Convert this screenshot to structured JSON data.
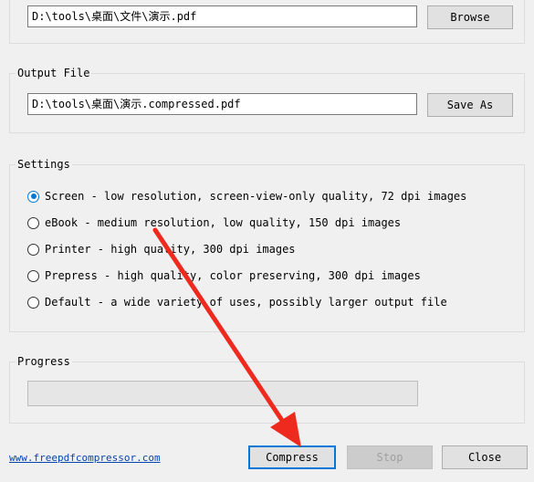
{
  "input_file": {
    "path": "D:\\tools\\桌面\\文件\\演示.pdf",
    "browse_label": "Browse"
  },
  "output_file": {
    "title": "Output File",
    "path": "D:\\tools\\桌面\\演示.compressed.pdf",
    "save_label": "Save As"
  },
  "settings": {
    "title": "Settings",
    "options": [
      {
        "label": "Screen - low resolution, screen-view-only quality, 72 dpi images",
        "checked": true
      },
      {
        "label": "eBook - medium resolution, low quality, 150 dpi images",
        "checked": false
      },
      {
        "label": "Printer - high quality, 300 dpi images",
        "checked": false
      },
      {
        "label": "Prepress - high quality, color preserving, 300 dpi images",
        "checked": false
      },
      {
        "label": "Default - a wide variety of uses, possibly larger output file",
        "checked": false
      }
    ]
  },
  "progress": {
    "title": "Progress",
    "value": 0
  },
  "footer": {
    "link_text": "www.freepdfcompressor.com",
    "compress_label": "Compress",
    "stop_label": "Stop",
    "close_label": "Close"
  },
  "colors": {
    "accent": "#0078d7",
    "annotation_arrow": "#ee2a1e",
    "link": "#0645ad"
  }
}
